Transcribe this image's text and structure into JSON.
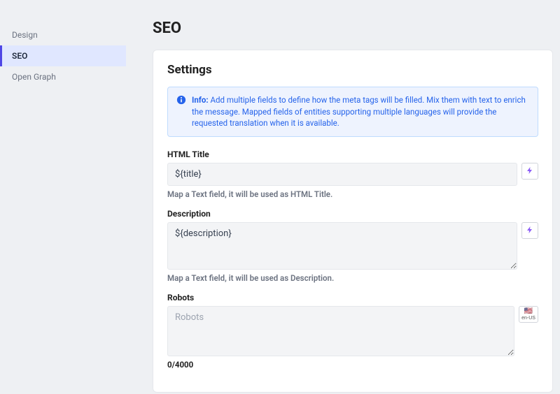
{
  "sidebar": {
    "items": [
      {
        "label": "Design",
        "active": false
      },
      {
        "label": "SEO",
        "active": true
      },
      {
        "label": "Open Graph",
        "active": false
      }
    ]
  },
  "page": {
    "title": "SEO"
  },
  "settings": {
    "heading": "Settings",
    "info_label": "Info:",
    "info_text": "Add multiple fields to define how the meta tags will be filled. Mix them with text to enrich the message. Mapped fields of entities supporting multiple languages will provide the requested translation when it is available.",
    "html_title": {
      "label": "HTML Title",
      "value": "${title}",
      "help": "Map a Text field, it will be used as HTML Title."
    },
    "description": {
      "label": "Description",
      "value": "${description}",
      "help": "Map a Text field, it will be used as Description."
    },
    "robots": {
      "label": "Robots",
      "placeholder": "Robots",
      "value": "",
      "counter": "0/4000",
      "locale": "en-US",
      "flag": "🇺🇸"
    }
  }
}
